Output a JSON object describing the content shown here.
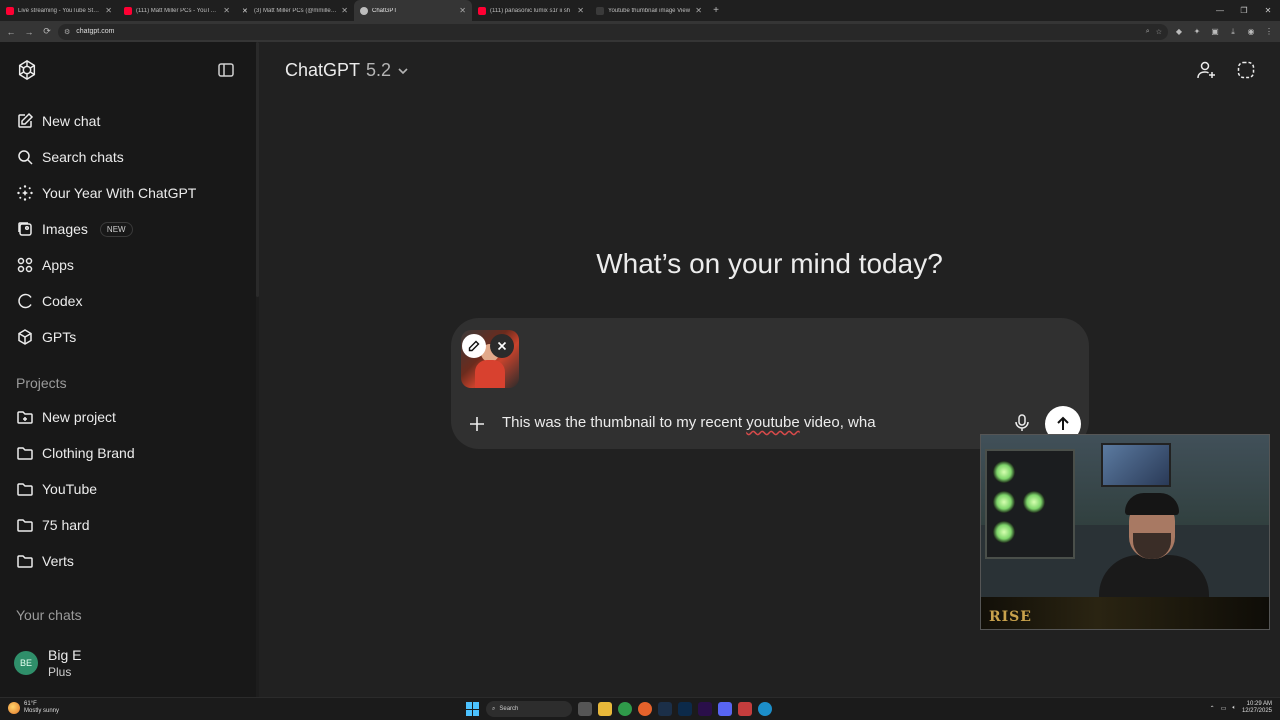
{
  "browser": {
    "tabs": [
      {
        "label": "Live streaming - YouTube Studio",
        "favicon_color": "#ff0033"
      },
      {
        "label": "(111) Matt Miller PCs - YouTube",
        "favicon_color": "#ff0033"
      },
      {
        "label": "(3) Matt Miller PCs (@mmillerpc",
        "favicon_color": "#e7e7e7"
      },
      {
        "label": "ChatGPT",
        "favicon_color": "#bdbdbd",
        "active": true
      },
      {
        "label": "(111) panasonic lumix s1r ii sh",
        "favicon_color": "#ff0033"
      },
      {
        "label": "Youtube thumbnail image View",
        "favicon_color": "#3a3a3a"
      }
    ],
    "new_tab": "+",
    "url": "chatgpt.com"
  },
  "sidebar": {
    "items": [
      {
        "label": "New chat",
        "icon": "edit-icon"
      },
      {
        "label": "Search chats",
        "icon": "search-icon"
      },
      {
        "label": "Your Year With ChatGPT",
        "icon": "sparkle-icon"
      },
      {
        "label": "Images",
        "icon": "images-icon",
        "badge": "NEW"
      },
      {
        "label": "Apps",
        "icon": "apps-icon"
      },
      {
        "label": "Codex",
        "icon": "codex-icon"
      },
      {
        "label": "GPTs",
        "icon": "cube-icon"
      }
    ],
    "projects_heading": "Projects",
    "projects": [
      {
        "label": "New project",
        "icon": "folder-plus-icon"
      },
      {
        "label": "Clothing Brand",
        "icon": "folder-icon"
      },
      {
        "label": "YouTube",
        "icon": "folder-icon"
      },
      {
        "label": "75 hard",
        "icon": "folder-icon"
      },
      {
        "label": "Verts",
        "icon": "folder-icon"
      }
    ],
    "chats_heading": "Your chats",
    "user": {
      "initials": "BE",
      "name": "Big E",
      "plan": "Plus"
    }
  },
  "main": {
    "model_name": "ChatGPT",
    "model_version": "5.2",
    "headline": "What’s on your mind today?",
    "composer": {
      "prompt_before": "This was the thumbnail to my recent ",
      "prompt_misspelled": "youtube",
      "prompt_after": " video, wha"
    }
  },
  "webcam": {
    "overlay_text": "RISE"
  },
  "taskbar": {
    "temp": "61°F",
    "weather": "Mostly sunny",
    "search": "Search",
    "time": "10:29 AM",
    "date": "12/27/2025"
  },
  "colors": {
    "sidebar_bg": "#181818",
    "main_bg": "#212121",
    "composer_bg": "#303030",
    "text": "#ececec"
  }
}
